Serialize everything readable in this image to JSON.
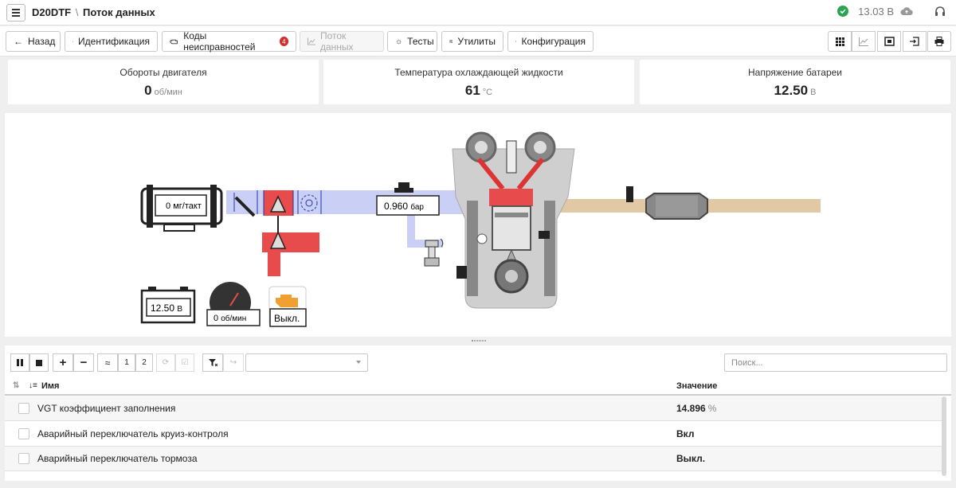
{
  "header": {
    "vehicle": "D20DTF",
    "separator": "\\",
    "page": "Поток данных",
    "voltage": "13.03 В"
  },
  "toolbar": {
    "back": "Назад",
    "identification": "Идентификация",
    "fault_codes": "Коды неисправностей",
    "fault_count": "4",
    "data_stream": "Поток данных",
    "tests": "Тесты",
    "utilities": "Утилиты",
    "configuration": "Конфигурация"
  },
  "gauges": [
    {
      "label": "Обороты двигателя",
      "value": "0",
      "unit": "об/мин"
    },
    {
      "label": "Температура охлаждающей жидкости",
      "value": "61",
      "unit": "°C"
    },
    {
      "label": "Напряжение батареи",
      "value": "12.50",
      "unit": "В"
    }
  ],
  "diagram": {
    "maf": {
      "value": "0",
      "unit": "мг/такт"
    },
    "boost": {
      "value": "0.960",
      "unit": "бар"
    },
    "battery": {
      "value": "12.50",
      "unit": "В"
    },
    "rpm": {
      "value": "0",
      "unit": "об/мин"
    },
    "mil": "Выкл."
  },
  "datapanel": {
    "page1": "1",
    "page2": "2",
    "search_placeholder": "Поиск...",
    "columns": {
      "name": "Имя",
      "value": "Значение"
    },
    "rows": [
      {
        "name": "VGT коэффициент заполнения",
        "value": "14.896",
        "unit": "%"
      },
      {
        "name": "Аварийный переключатель круиз-контроля",
        "value": "Вкл",
        "unit": ""
      },
      {
        "name": "Аварийный переключатель тормоза",
        "value": "Выкл.",
        "unit": ""
      }
    ]
  },
  "colors": {
    "intake": "#c9cff5",
    "turbo": "#e84b4b",
    "exhaust": "#e2c9a6",
    "ok": "#2aa44f",
    "badge": "#d32f2f",
    "mil": "#f0a030"
  }
}
